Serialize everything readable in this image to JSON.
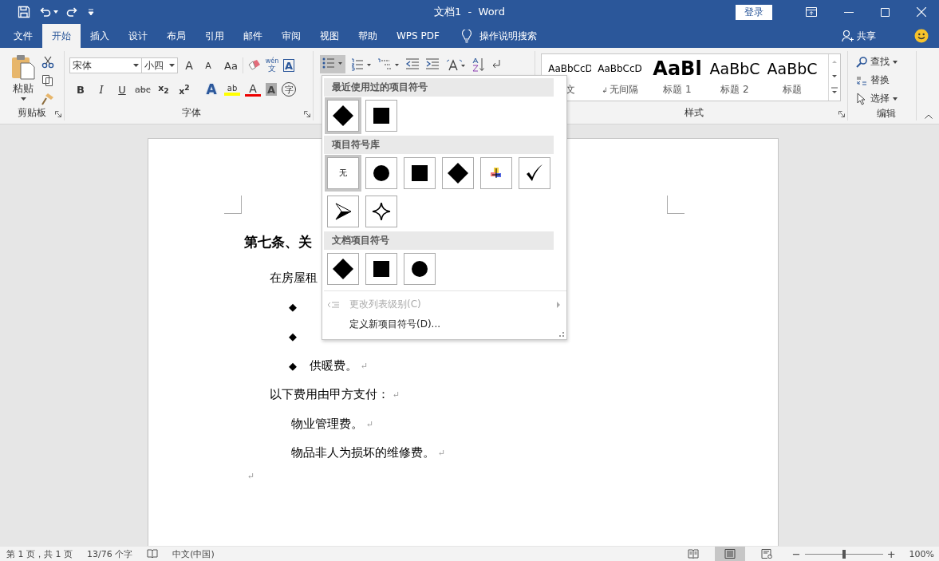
{
  "title_bar": {
    "title": "文档1  -  Word",
    "login_button": "登录"
  },
  "tabs": [
    {
      "label": "文件",
      "selected": false
    },
    {
      "label": "开始",
      "selected": true
    },
    {
      "label": "插入",
      "selected": false
    },
    {
      "label": "设计",
      "selected": false
    },
    {
      "label": "布局",
      "selected": false
    },
    {
      "label": "引用",
      "selected": false
    },
    {
      "label": "邮件",
      "selected": false
    },
    {
      "label": "审阅",
      "selected": false
    },
    {
      "label": "视图",
      "selected": false
    },
    {
      "label": "帮助",
      "selected": false
    },
    {
      "label": "WPS PDF",
      "selected": false
    }
  ],
  "tell_me": "操作说明搜索",
  "share_button": "共享",
  "clipboard": {
    "paste_label": "粘贴",
    "group_label": "剪贴板"
  },
  "font": {
    "font_name": "宋体",
    "font_size": "小四",
    "group_label": "字体",
    "row1_tools": [
      {
        "kind": "grow",
        "glyph": "A"
      },
      {
        "kind": "shrink",
        "glyph": "A"
      },
      {
        "kind": "case",
        "glyph": "Aa"
      },
      {
        "kind": "clear"
      },
      {
        "kind": "pinyin",
        "glyph": "wén",
        "sub": "文"
      },
      {
        "kind": "border",
        "glyph": "A"
      }
    ],
    "row2_tools": [
      {
        "kind": "bold",
        "glyph": "B"
      },
      {
        "kind": "italic",
        "glyph": "I"
      },
      {
        "kind": "underline",
        "glyph": "U"
      },
      {
        "kind": "strike",
        "glyph": "abc"
      },
      {
        "kind": "script",
        "glyph": "x$_{2}$"
      },
      {
        "kind": "script",
        "glyph": "x$^{2}$"
      },
      {
        "kind": "effects",
        "glyph": "A"
      },
      {
        "kind": "highlight",
        "glyph": "ab"
      },
      {
        "kind": "color",
        "glyph": "A"
      },
      {
        "kind": "shading",
        "glyph": "A"
      },
      {
        "kind": "enclose",
        "glyph": "字"
      }
    ]
  },
  "paragraph": {
    "bullets_active": true
  },
  "styles": {
    "group_label": "样式",
    "items": [
      {
        "kind": "normal",
        "preview": "AaBbCcD",
        "name": "文"
      },
      {
        "kind": "normal",
        "preview": "AaBbCcD",
        "name": "无间隔",
        "mark": "↲"
      },
      {
        "kind": "heading1",
        "preview": "AaBl",
        "name": "标题 1"
      },
      {
        "kind": "heading2",
        "preview": "AaBbC",
        "name": "标题 2"
      },
      {
        "kind": "title",
        "preview": "AaBbC",
        "name": "标题"
      }
    ]
  },
  "editing": {
    "group_label": "编辑",
    "items": [
      {
        "kind": "find",
        "label": "查找",
        "has_menu": true
      },
      {
        "kind": "replace",
        "label": "替换",
        "has_menu": false
      },
      {
        "kind": "select",
        "label": "选择",
        "has_menu": true
      }
    ]
  },
  "bullet_menu": {
    "sections": [
      {
        "title": "最近使用过的项目符号",
        "bullets": [
          {
            "kind": "diamond",
            "selected": true
          },
          {
            "kind": "square",
            "selected": false
          }
        ]
      },
      {
        "title": "项目符号库",
        "bullets": [
          {
            "kind": "none",
            "label": "无",
            "selected": true
          },
          {
            "kind": "circle",
            "selected": false
          },
          {
            "kind": "square",
            "selected": false
          },
          {
            "kind": "diamond",
            "selected": false
          },
          {
            "kind": "picture",
            "selected": false
          },
          {
            "kind": "check",
            "selected": false
          },
          {
            "kind": "arrow",
            "selected": false
          },
          {
            "kind": "star",
            "selected": false
          }
        ]
      },
      {
        "title": "文档项目符号",
        "bullets": [
          {
            "kind": "diamond",
            "selected": false
          },
          {
            "kind": "square",
            "selected": false
          },
          {
            "kind": "circle",
            "selected": false
          }
        ]
      }
    ],
    "commands": [
      {
        "kind": "list_level",
        "label": "更改列表级别(C)",
        "disabled": true
      },
      {
        "kind": "define",
        "label": "定义新项目符号(D)...",
        "disabled": false
      }
    ]
  },
  "document": {
    "heading": "第七条、关",
    "paragraphs": [
      {
        "kind": "body",
        "text": "在房屋租"
      },
      {
        "kind": "bullet",
        "bullet": "◆"
      },
      {
        "kind": "bullet",
        "bullet": "◆"
      },
      {
        "kind": "bullet",
        "bullet": "◆",
        "text": "供暖费。",
        "mark": "↵"
      },
      {
        "kind": "body",
        "text": "以下费用由甲方支付：",
        "mark": "↵"
      },
      {
        "kind": "indent",
        "text": "物业管理费。",
        "mark": "↵"
      },
      {
        "kind": "indent",
        "text": "物品非人为损坏的维修费。",
        "mark": "↵"
      },
      {
        "kind": "empty",
        "mark": "↵"
      }
    ]
  },
  "status_bar": {
    "page_info": "第 1 页，共 1 页",
    "word_count": "13/76 个字",
    "language": "中文(中国)",
    "views": [
      {
        "kind": "read",
        "selected": false
      },
      {
        "kind": "print",
        "selected": true
      },
      {
        "kind": "web",
        "selected": false
      }
    ],
    "zoom": {
      "minus": "−",
      "plus": "+",
      "level": 0.5,
      "percent": "100%"
    }
  }
}
